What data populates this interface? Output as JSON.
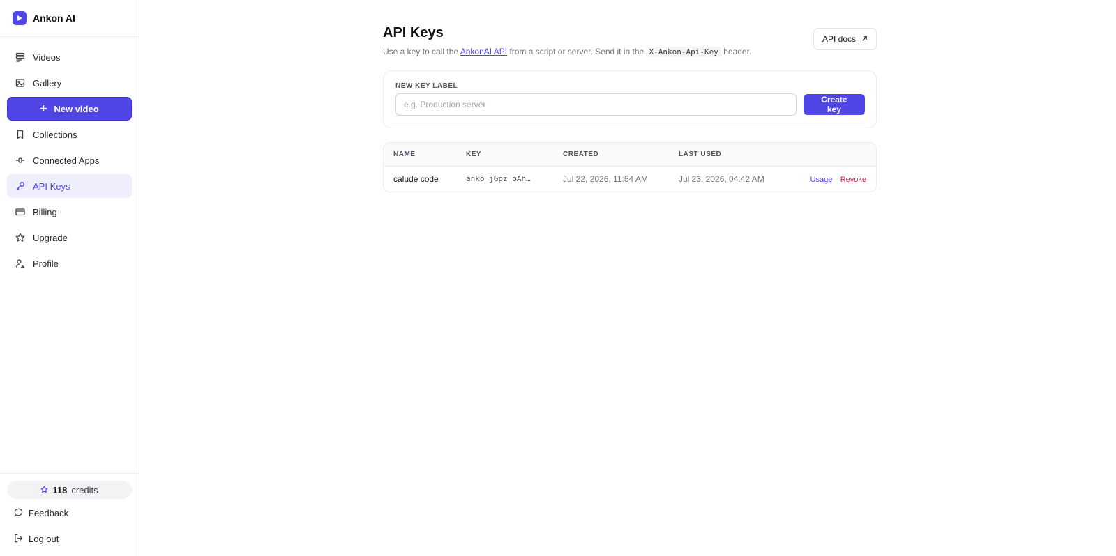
{
  "brand": {
    "name": "Ankon AI"
  },
  "sidebar": {
    "items": [
      {
        "label": "Videos"
      },
      {
        "label": "Gallery"
      },
      {
        "label": "Collections"
      },
      {
        "label": "Connected Apps"
      },
      {
        "label": "API Keys"
      },
      {
        "label": "Billing"
      },
      {
        "label": "Upgrade"
      },
      {
        "label": "Profile"
      }
    ],
    "new_video_label": "New video",
    "credits": {
      "count": "118",
      "label": "credits"
    },
    "feedback_label": "Feedback",
    "logout_label": "Log out"
  },
  "main": {
    "title": "API Keys",
    "subtitle": {
      "before": "Use a key to call the ",
      "link": "AnkonAI API",
      "middle": " from a script or server. Send it in the ",
      "code": "X-Ankon-Api-Key",
      "after": " header."
    },
    "docs_button": "API docs",
    "form": {
      "label": "NEW KEY LABEL",
      "placeholder": "e.g. Production server",
      "value": "",
      "button": "Create key"
    },
    "table": {
      "columns": [
        "NAME",
        "KEY",
        "CREATED",
        "LAST USED"
      ],
      "rows": [
        {
          "name": "calude code",
          "key": "anko_jGpz_oAh…",
          "created": "Jul 22, 2026, 11:54 AM",
          "last_used": "Jul 23, 2026, 04:42 AM",
          "usage_label": "Usage",
          "revoke_label": "Revoke"
        }
      ]
    }
  },
  "colors": {
    "accent": "#4f46e5",
    "danger": "#e11d48",
    "active_bg": "#eeeefd"
  }
}
